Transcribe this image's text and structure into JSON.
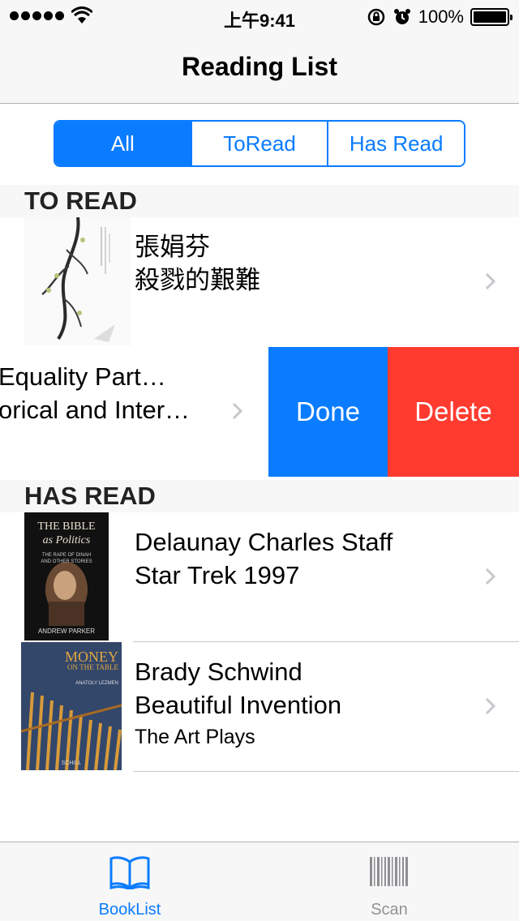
{
  "status": {
    "time": "上午9:41",
    "battery": "100%",
    "battery_level": 1.0
  },
  "nav": {
    "title": "Reading List"
  },
  "segments": [
    "All",
    "ToRead",
    "Has Read"
  ],
  "selected_segment": "All",
  "sections": {
    "to_read": {
      "title": "TO READ",
      "rows": [
        {
          "line1": "張娟芬",
          "line2": "殺戮的艱難"
        },
        {
          "line1": "Equality Part…",
          "line2": "orical and Inter…",
          "actions": {
            "done": "Done",
            "delete": "Delete"
          }
        }
      ]
    },
    "has_read": {
      "title": "HAS READ",
      "rows": [
        {
          "line1": "Delaunay Charles Staff",
          "line2": "Star Trek 1997",
          "cover": {
            "title": "THE BIBLE",
            "subtitle": "as Politics",
            "tagline1": "THE RAPE OF DINAH",
            "tagline2": "AND OTHER STORIES",
            "author": "ANDREW PARKER"
          }
        },
        {
          "line1": "Brady Schwind",
          "line2": "Beautiful Invention",
          "line3": "The Art Plays",
          "cover": {
            "title": "MONEY",
            "subtitle": "ON THE TABLE",
            "author": "ANATOLY LEZMEN",
            "footer": "SCHILL"
          }
        }
      ]
    }
  },
  "tabbar": {
    "tabs": [
      {
        "label": "BookList",
        "icon": "book-icon",
        "active": true
      },
      {
        "label": "Scan",
        "icon": "barcode-icon",
        "active": false
      }
    ]
  },
  "colors": {
    "accent": "#0a7cff",
    "delete": "#ff3b30",
    "inactive": "#929292"
  }
}
